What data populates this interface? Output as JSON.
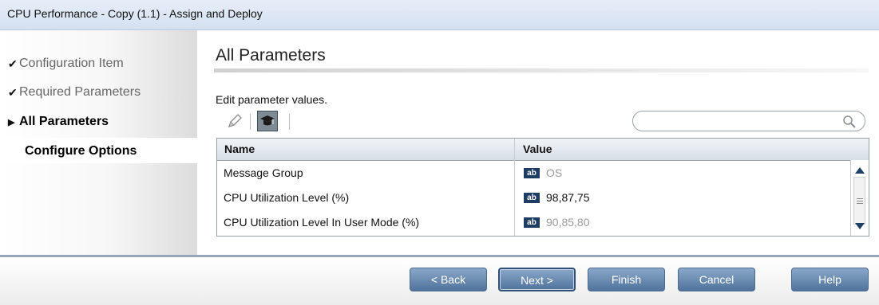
{
  "window": {
    "title": "CPU Performance - Copy (1.1) - Assign and Deploy"
  },
  "sidebar": {
    "steps": [
      {
        "label": "Configuration Item",
        "state": "done",
        "marker": "✔"
      },
      {
        "label": "Required Parameters",
        "state": "done",
        "marker": "✔"
      },
      {
        "label": "All Parameters",
        "state": "active",
        "marker": "▶"
      },
      {
        "label": "Configure Options",
        "state": "pending",
        "marker": ""
      }
    ]
  },
  "main": {
    "title": "All Parameters",
    "instruction": "Edit parameter values."
  },
  "toolbar": {
    "icons": [
      "pencil-icon",
      "graduation-cap-icon"
    ]
  },
  "search": {
    "placeholder": "",
    "icon": "search-icon"
  },
  "table": {
    "columns": [
      "Name",
      "Value"
    ],
    "rows": [
      {
        "name": "Message Group",
        "type_badge": "ab",
        "value": "OS",
        "muted": true
      },
      {
        "name": "CPU Utilization Level (%)",
        "type_badge": "ab",
        "value": "98,87,75",
        "muted": false
      },
      {
        "name": "CPU Utilization Level In User Mode (%)",
        "type_badge": "ab",
        "value": "90,85,80",
        "muted": true
      }
    ]
  },
  "buttons": {
    "back": "< Back",
    "next": "Next >",
    "finish": "Finish",
    "cancel": "Cancel",
    "help": "Help"
  },
  "colors": {
    "button": "#6a8cb3",
    "badge": "#1f3d63",
    "footer_line": "#96a7bd"
  }
}
